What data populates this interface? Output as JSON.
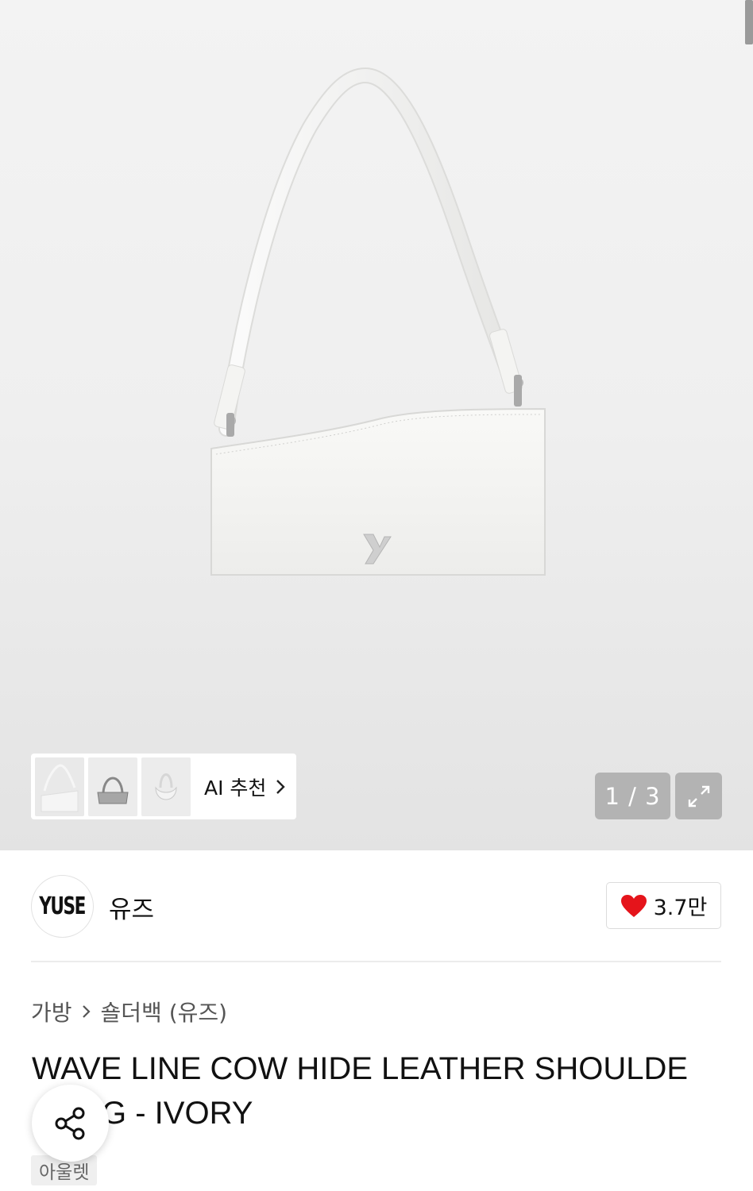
{
  "gallery": {
    "counter_text": "1 / 3",
    "current_index": 1,
    "total_images": 3,
    "ai_recommend_label": "AI 추천",
    "thumbnails": [
      "shoulder-bag-thumb",
      "bag-thumb",
      "hobo-bag-thumb"
    ]
  },
  "brand": {
    "logo_text": "YUSE",
    "name": "유즈",
    "likes_label": "3.7만"
  },
  "breadcrumb": [
    "가방",
    "숄더백 (유즈)"
  ],
  "product": {
    "title_line1": "WAVE LINE COW HIDE LEATHER SHOULDE",
    "title_line2": "G - IVORY",
    "tag": "아울렛"
  },
  "colors": {
    "heart": "#e5141b",
    "overlay_button": "#b3b3b3"
  },
  "icons": [
    "chevron-right-icon",
    "expand-icon",
    "heart-icon",
    "share-icon"
  ]
}
